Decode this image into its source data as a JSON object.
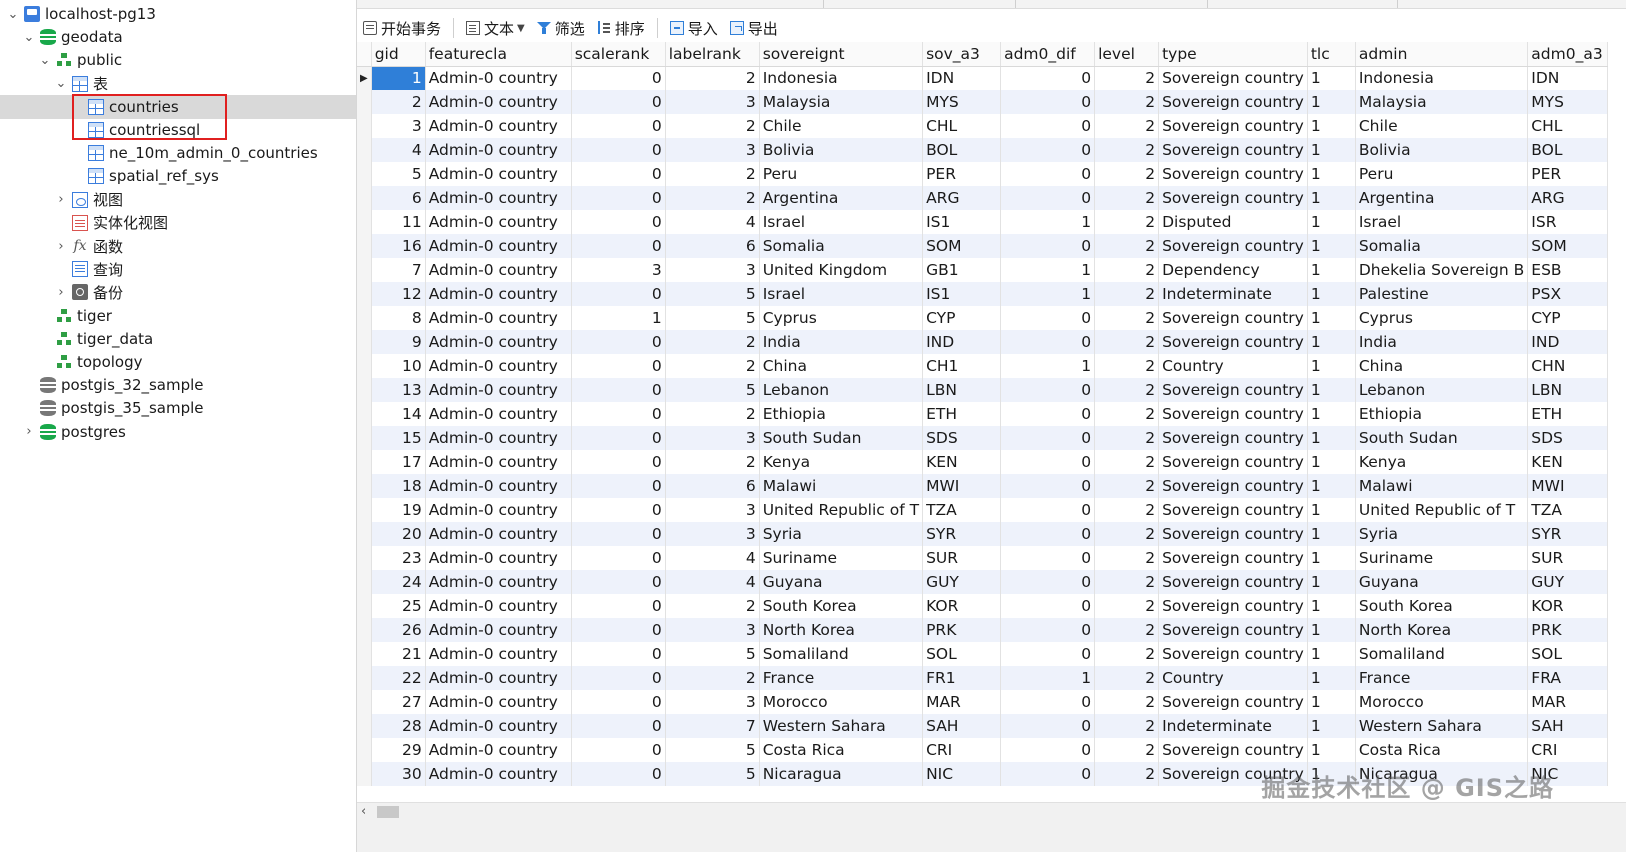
{
  "sidebar": {
    "items": [
      {
        "label": "localhost-pg13",
        "icon": "connection-icon",
        "level": 0,
        "expanded": true
      },
      {
        "label": "geodata",
        "icon": "database-icon",
        "level": 1,
        "expanded": true
      },
      {
        "label": "public",
        "icon": "schema-icon",
        "level": 2,
        "expanded": true
      },
      {
        "label": "表",
        "icon": "tables-folder-icon",
        "level": 3,
        "expanded": true
      },
      {
        "label": "countries",
        "icon": "table-icon",
        "level": 4,
        "selected": true
      },
      {
        "label": "countriessql",
        "icon": "table-icon",
        "level": 4
      },
      {
        "label": "ne_10m_admin_0_countries",
        "icon": "table-icon",
        "level": 4
      },
      {
        "label": "spatial_ref_sys",
        "icon": "table-icon",
        "level": 4
      },
      {
        "label": "视图",
        "icon": "views-icon",
        "level": 3,
        "expanded": false
      },
      {
        "label": "实体化视图",
        "icon": "materialized-views-icon",
        "level": 3
      },
      {
        "label": "函数",
        "icon": "function-icon",
        "level": 3,
        "expanded": false
      },
      {
        "label": "查询",
        "icon": "query-icon",
        "level": 3
      },
      {
        "label": "备份",
        "icon": "backup-icon",
        "level": 3,
        "expanded": false
      },
      {
        "label": "tiger",
        "icon": "schema-icon",
        "level": 2
      },
      {
        "label": "tiger_data",
        "icon": "schema-icon",
        "level": 2
      },
      {
        "label": "topology",
        "icon": "schema-icon",
        "level": 2
      },
      {
        "label": "postgis_32_sample",
        "icon": "database-gray-icon",
        "level": 1
      },
      {
        "label": "postgis_35_sample",
        "icon": "database-gray-icon",
        "level": 1
      },
      {
        "label": "postgres",
        "icon": "database-icon",
        "level": 1,
        "expanded": false
      }
    ]
  },
  "toolbar": {
    "begin_transaction": "开始事务",
    "text": "文本",
    "filter": "筛选",
    "sort": "排序",
    "import": "导入",
    "export": "导出"
  },
  "grid": {
    "columns": [
      "gid",
      "featurecla",
      "scalerank",
      "labelrank",
      "sovereignt",
      "sov_a3",
      "adm0_dif",
      "level",
      "type",
      "tlc",
      "admin",
      "adm0_a3"
    ],
    "rows": [
      [
        "1",
        "Admin-0 country",
        "0",
        "2",
        "Indonesia",
        "IDN",
        "0",
        "2",
        "Sovereign country",
        "1",
        "Indonesia",
        "IDN"
      ],
      [
        "2",
        "Admin-0 country",
        "0",
        "3",
        "Malaysia",
        "MYS",
        "0",
        "2",
        "Sovereign country",
        "1",
        "Malaysia",
        "MYS"
      ],
      [
        "3",
        "Admin-0 country",
        "0",
        "2",
        "Chile",
        "CHL",
        "0",
        "2",
        "Sovereign country",
        "1",
        "Chile",
        "CHL"
      ],
      [
        "4",
        "Admin-0 country",
        "0",
        "3",
        "Bolivia",
        "BOL",
        "0",
        "2",
        "Sovereign country",
        "1",
        "Bolivia",
        "BOL"
      ],
      [
        "5",
        "Admin-0 country",
        "0",
        "2",
        "Peru",
        "PER",
        "0",
        "2",
        "Sovereign country",
        "1",
        "Peru",
        "PER"
      ],
      [
        "6",
        "Admin-0 country",
        "0",
        "2",
        "Argentina",
        "ARG",
        "0",
        "2",
        "Sovereign country",
        "1",
        "Argentina",
        "ARG"
      ],
      [
        "11",
        "Admin-0 country",
        "0",
        "4",
        "Israel",
        "IS1",
        "1",
        "2",
        "Disputed",
        "1",
        "Israel",
        "ISR"
      ],
      [
        "16",
        "Admin-0 country",
        "0",
        "6",
        "Somalia",
        "SOM",
        "0",
        "2",
        "Sovereign country",
        "1",
        "Somalia",
        "SOM"
      ],
      [
        "7",
        "Admin-0 country",
        "3",
        "3",
        "United Kingdom",
        "GB1",
        "1",
        "2",
        "Dependency",
        "1",
        "Dhekelia Sovereign B",
        "ESB"
      ],
      [
        "12",
        "Admin-0 country",
        "0",
        "5",
        "Israel",
        "IS1",
        "1",
        "2",
        "Indeterminate",
        "1",
        "Palestine",
        "PSX"
      ],
      [
        "8",
        "Admin-0 country",
        "1",
        "5",
        "Cyprus",
        "CYP",
        "0",
        "2",
        "Sovereign country",
        "1",
        "Cyprus",
        "CYP"
      ],
      [
        "9",
        "Admin-0 country",
        "0",
        "2",
        "India",
        "IND",
        "0",
        "2",
        "Sovereign country",
        "1",
        "India",
        "IND"
      ],
      [
        "10",
        "Admin-0 country",
        "0",
        "2",
        "China",
        "CH1",
        "1",
        "2",
        "Country",
        "1",
        "China",
        "CHN"
      ],
      [
        "13",
        "Admin-0 country",
        "0",
        "5",
        "Lebanon",
        "LBN",
        "0",
        "2",
        "Sovereign country",
        "1",
        "Lebanon",
        "LBN"
      ],
      [
        "14",
        "Admin-0 country",
        "0",
        "2",
        "Ethiopia",
        "ETH",
        "0",
        "2",
        "Sovereign country",
        "1",
        "Ethiopia",
        "ETH"
      ],
      [
        "15",
        "Admin-0 country",
        "0",
        "3",
        "South Sudan",
        "SDS",
        "0",
        "2",
        "Sovereign country",
        "1",
        "South Sudan",
        "SDS"
      ],
      [
        "17",
        "Admin-0 country",
        "0",
        "2",
        "Kenya",
        "KEN",
        "0",
        "2",
        "Sovereign country",
        "1",
        "Kenya",
        "KEN"
      ],
      [
        "18",
        "Admin-0 country",
        "0",
        "6",
        "Malawi",
        "MWI",
        "0",
        "2",
        "Sovereign country",
        "1",
        "Malawi",
        "MWI"
      ],
      [
        "19",
        "Admin-0 country",
        "0",
        "3",
        "United Republic of T",
        "TZA",
        "0",
        "2",
        "Sovereign country",
        "1",
        "United Republic of T",
        "TZA"
      ],
      [
        "20",
        "Admin-0 country",
        "0",
        "3",
        "Syria",
        "SYR",
        "0",
        "2",
        "Sovereign country",
        "1",
        "Syria",
        "SYR"
      ],
      [
        "23",
        "Admin-0 country",
        "0",
        "4",
        "Suriname",
        "SUR",
        "0",
        "2",
        "Sovereign country",
        "1",
        "Suriname",
        "SUR"
      ],
      [
        "24",
        "Admin-0 country",
        "0",
        "4",
        "Guyana",
        "GUY",
        "0",
        "2",
        "Sovereign country",
        "1",
        "Guyana",
        "GUY"
      ],
      [
        "25",
        "Admin-0 country",
        "0",
        "2",
        "South Korea",
        "KOR",
        "0",
        "2",
        "Sovereign country",
        "1",
        "South Korea",
        "KOR"
      ],
      [
        "26",
        "Admin-0 country",
        "0",
        "3",
        "North Korea",
        "PRK",
        "0",
        "2",
        "Sovereign country",
        "1",
        "North Korea",
        "PRK"
      ],
      [
        "21",
        "Admin-0 country",
        "0",
        "5",
        "Somaliland",
        "SOL",
        "0",
        "2",
        "Sovereign country",
        "1",
        "Somaliland",
        "SOL"
      ],
      [
        "22",
        "Admin-0 country",
        "0",
        "2",
        "France",
        "FR1",
        "1",
        "2",
        "Country",
        "1",
        "France",
        "FRA"
      ],
      [
        "27",
        "Admin-0 country",
        "0",
        "3",
        "Morocco",
        "MAR",
        "0",
        "2",
        "Sovereign country",
        "1",
        "Morocco",
        "MAR"
      ],
      [
        "28",
        "Admin-0 country",
        "0",
        "7",
        "Western Sahara",
        "SAH",
        "0",
        "2",
        "Indeterminate",
        "1",
        "Western Sahara",
        "SAH"
      ],
      [
        "29",
        "Admin-0 country",
        "0",
        "5",
        "Costa Rica",
        "CRI",
        "0",
        "2",
        "Sovereign country",
        "1",
        "Costa Rica",
        "CRI"
      ],
      [
        "30",
        "Admin-0 country",
        "0",
        "5",
        "Nicaragua",
        "NIC",
        "0",
        "2",
        "Sovereign country",
        "1",
        "Nicaragua",
        "NIC"
      ]
    ]
  },
  "watermark": "掘金技术社区 @ GIS之路",
  "colors": {
    "selection": "#2f7fd8",
    "highlight_box": "#e02020",
    "alt_row": "#eef2fb"
  }
}
